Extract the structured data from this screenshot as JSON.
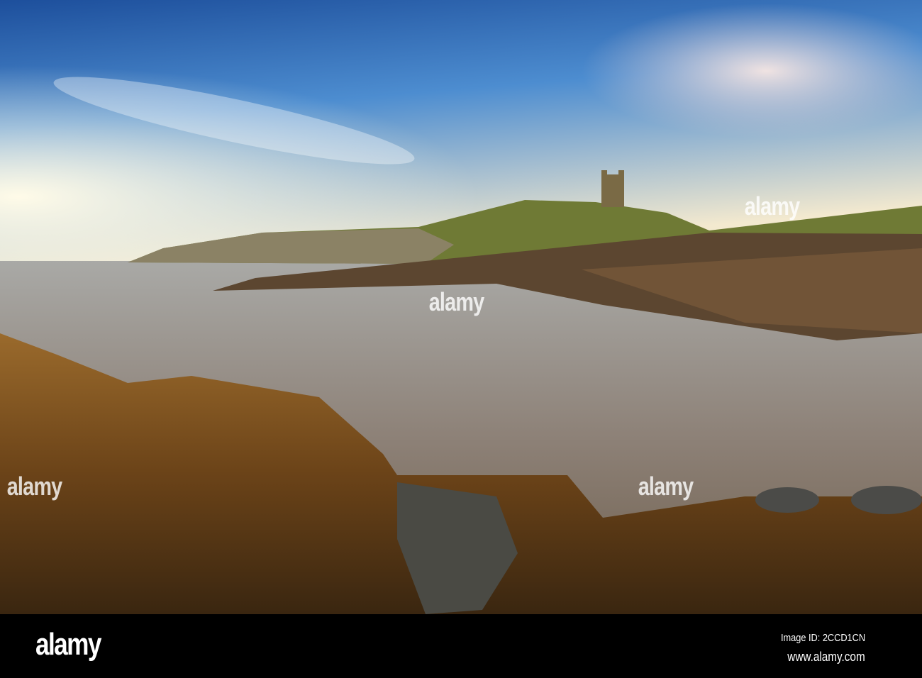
{
  "footer": {
    "logo": "alamy",
    "image_id": "Image ID: 2CCD1CN",
    "url": "www.alamy.com"
  },
  "watermarks": [
    "alamy",
    "alamy",
    "alamy",
    "alamy"
  ]
}
